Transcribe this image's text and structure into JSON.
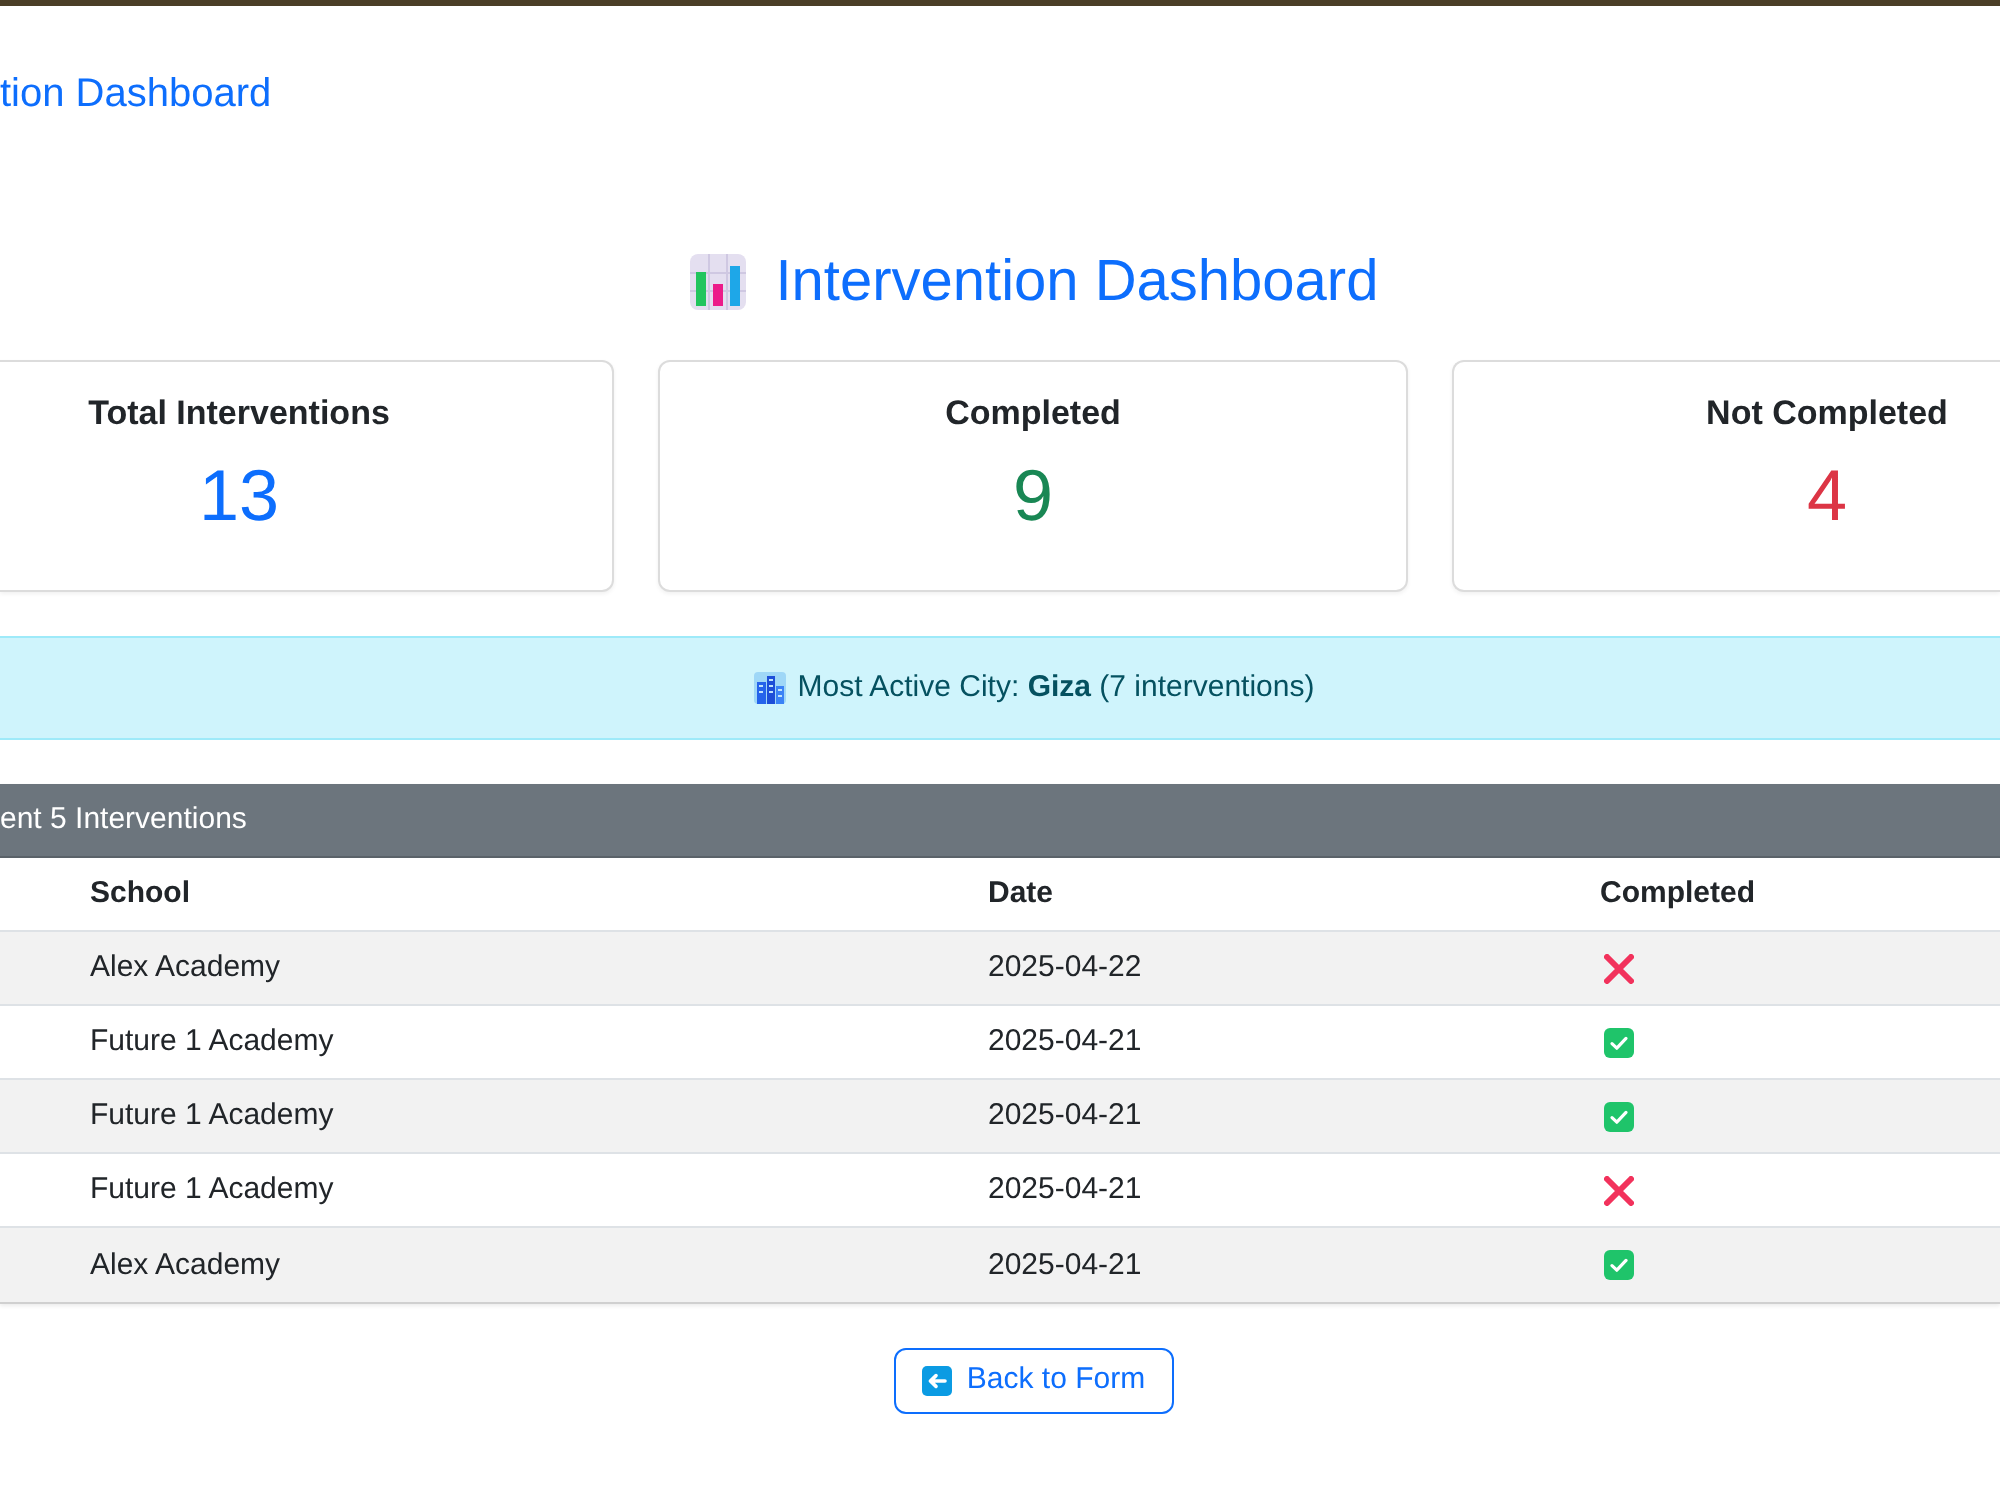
{
  "navbar": {
    "brand": "tion Dashboard"
  },
  "header": {
    "title": "Intervention Dashboard"
  },
  "stats": [
    {
      "label": "Total Interventions",
      "value": "13",
      "color": "#0d6efd"
    },
    {
      "label": "Completed",
      "value": "9",
      "color": "#198754"
    },
    {
      "label": "Not Completed",
      "value": "4",
      "color": "#dc3545"
    }
  ],
  "alert": {
    "text": "Most Active City: **Giza** (7 interventions)"
  },
  "table": {
    "title": "ent 5 Interventions",
    "columns": [
      "School",
      "Date",
      "Completed"
    ],
    "rows": [
      {
        "school": "Alex Academy",
        "date": "2025-04-22",
        "completed": false
      },
      {
        "school": "Future 1 Academy",
        "date": "2025-04-21",
        "completed": true
      },
      {
        "school": "Future 1 Academy",
        "date": "2025-04-21",
        "completed": true
      },
      {
        "school": "Future 1 Academy",
        "date": "2025-04-21",
        "completed": false
      },
      {
        "school": "Alex Academy",
        "date": "2025-04-21",
        "completed": true
      }
    ]
  },
  "button": {
    "label": "Back to Form"
  }
}
